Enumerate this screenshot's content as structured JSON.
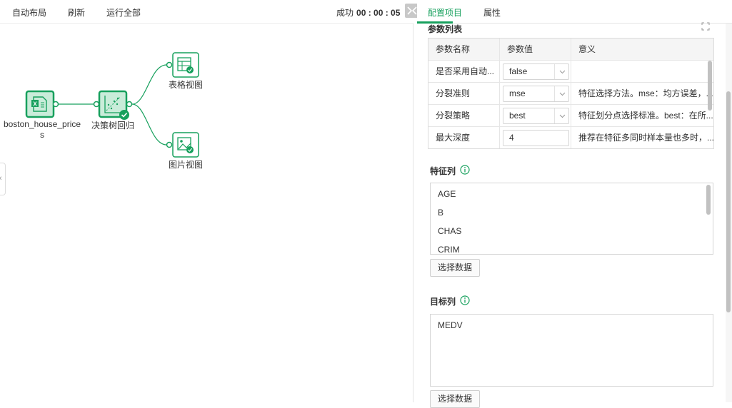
{
  "toolbar": {
    "auto_layout": "自动布局",
    "refresh": "刷新",
    "run_all": "运行全部",
    "status_label": "成功",
    "status_time": "00 : 00 : 05"
  },
  "canvas": {
    "nodes": {
      "source": {
        "label_line1": "boston_house_price",
        "label_line2": "s",
        "icon": "excel-file-icon"
      },
      "model": {
        "label": "决策树回归",
        "icon": "scatter-regression-icon",
        "status": "check-success-icon"
      },
      "table_view": {
        "label": "表格视图",
        "icon": "table-view-icon"
      },
      "image_view": {
        "label": "图片视图",
        "icon": "image-view-icon"
      }
    },
    "accent": "#17a05d",
    "node_fill": "#c9ecd9"
  },
  "tabs": {
    "config": "配置项目",
    "properties": "属性",
    "active": "config"
  },
  "params": {
    "title": "参数列表",
    "headers": [
      "参数名称",
      "参数值",
      "意义"
    ],
    "rows": [
      {
        "name": "是否采用自动...",
        "value": "false",
        "meaning": ""
      },
      {
        "name": "分裂准则",
        "value": "mse",
        "meaning": "特征选择方法。mse：均方误差，..."
      },
      {
        "name": "分裂策略",
        "value": "best",
        "meaning": "特征划分点选择标准。best：在所..."
      },
      {
        "name": "最大深度",
        "value": "4",
        "meaning": "推荐在特征多同时样本量也多时，..."
      }
    ]
  },
  "features": {
    "title": "特征列",
    "items": [
      "AGE",
      "B",
      "CHAS",
      "CRIM"
    ],
    "button": "选择数据"
  },
  "target": {
    "title": "目标列",
    "items": [
      "MEDV"
    ],
    "button": "选择数据"
  }
}
